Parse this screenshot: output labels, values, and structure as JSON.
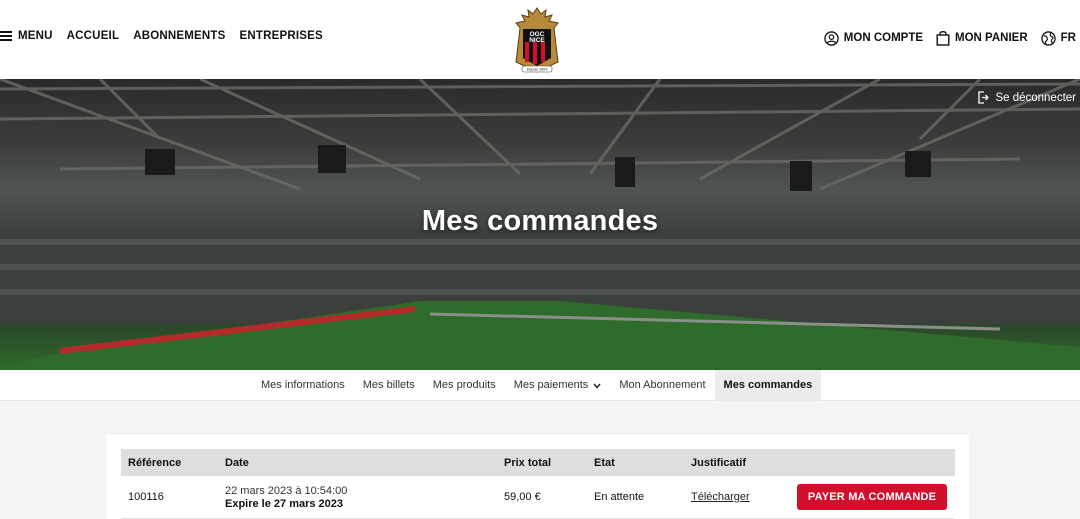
{
  "header": {
    "menu_label": "MENU",
    "nav_links": [
      "ACCUEIL",
      "ABONNEMENTS",
      "ENTREPRISES"
    ],
    "account_label": "MON COMPTE",
    "cart_label": "MON PANIER",
    "language_label": "FR",
    "logo": {
      "line1": "OGC",
      "line2": "NICE",
      "founded": "Depuis 1904"
    }
  },
  "hero": {
    "title": "Mes commandes",
    "logout_label": "Se déconnecter"
  },
  "subnav": {
    "tabs": [
      "Mes informations",
      "Mes billets",
      "Mes produits",
      "Mes paiements",
      "Mon Abonnement",
      "Mes commandes"
    ],
    "active_tab": "Mes commandes"
  },
  "orders": {
    "columns": [
      "Référence",
      "Date",
      "Prix total",
      "Etat",
      "Justificatif"
    ],
    "rows": [
      {
        "reference": "100116",
        "date": "22 mars 2023 à 10:54:00",
        "expires": "Expire le 27 mars 2023",
        "total": "59,00 €",
        "status": "En attente",
        "receipt_link": "Télécharger",
        "pay_button": "PAYER MA COMMANDE"
      }
    ]
  },
  "colors": {
    "accent_red": "#d2102b",
    "header_bg": "#ffffff",
    "page_bg": "#f4f4f4"
  }
}
